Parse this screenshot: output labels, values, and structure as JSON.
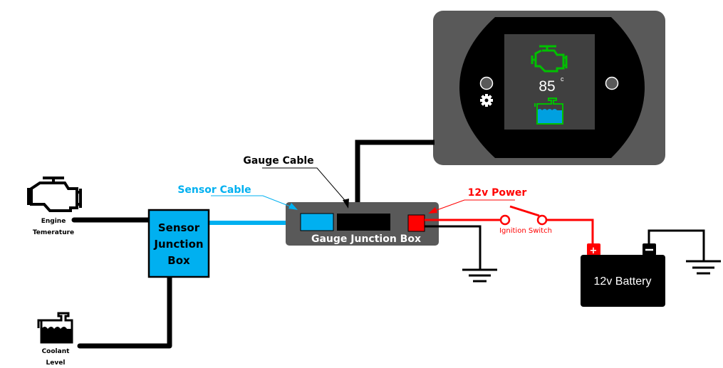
{
  "gauge": {
    "temperature_value": "85",
    "temperature_unit": "c",
    "engine_icon": "check-engine-icon",
    "coolant_icon": "coolant-tank-icon",
    "settings_icon": "gear-icon"
  },
  "labels": {
    "gauge_cable": "Gauge Cable",
    "sensor_cable": "Sensor Cable",
    "power_12v": "12v Power",
    "ignition_switch": "Ignition Switch",
    "gauge_junction_box": "Gauge Junction Box",
    "sensor_junction_box": [
      "Sensor",
      "Junction",
      "Box"
    ],
    "engine_temperature": [
      "Engine",
      "Temerature"
    ],
    "coolant_level": [
      "Coolant",
      "Level"
    ],
    "battery": "12v Battery",
    "battery_positive": "+",
    "battery_negative": "−"
  },
  "colors": {
    "sensor_blue": "#00b0f0",
    "power_red": "#ff0000",
    "gauge_green": "#00c000",
    "housing_gray": "#595959",
    "screen_gray": "#404040",
    "wire_black": "#000000"
  }
}
